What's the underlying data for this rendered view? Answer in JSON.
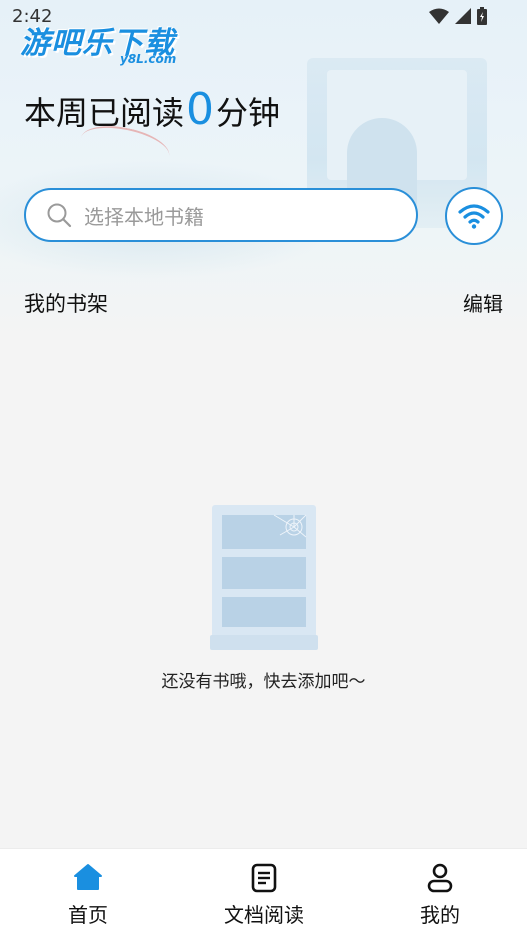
{
  "status_bar": {
    "time": "2:42"
  },
  "watermark": {
    "title": "游吧乐下载",
    "subtitle": "y8L.com"
  },
  "header": {
    "reading_prefix": "本周已阅读",
    "reading_minutes": "0",
    "reading_suffix": "分钟"
  },
  "search": {
    "placeholder": "选择本地书籍"
  },
  "shelf": {
    "title": "我的书架",
    "edit_label": "编辑",
    "empty_message": "还没有书哦，快去添加吧～"
  },
  "tabs": [
    {
      "label": "首页",
      "icon": "home-icon",
      "active": true
    },
    {
      "label": "文档阅读",
      "icon": "document-icon",
      "active": false
    },
    {
      "label": "我的",
      "icon": "user-icon",
      "active": false
    }
  ],
  "colors": {
    "accent": "#1a8fe0",
    "border": "#2a8fd8",
    "background": "#f4f4f4"
  }
}
